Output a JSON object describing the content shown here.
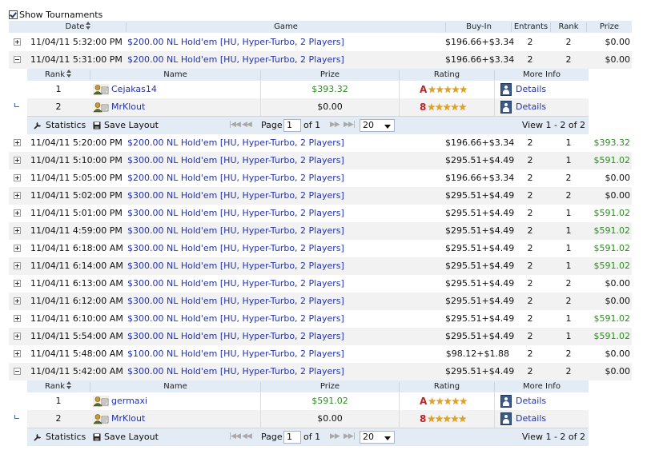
{
  "show_tournaments": {
    "label": "Show Tournaments",
    "checked": true
  },
  "columns": {
    "date": "Date",
    "game": "Game",
    "buyin": "Buy-In",
    "entrants": "Entrants",
    "rank": "Rank",
    "prize": "Prize"
  },
  "sub_columns": {
    "rank": "Rank",
    "name": "Name",
    "prize": "Prize",
    "rating": "Rating",
    "more_info": "More Info"
  },
  "pager": {
    "statistics": "Statistics",
    "save_layout": "Save Layout",
    "page_label": "Page",
    "page_value": "1",
    "of_label": "of 1",
    "page_size": "20",
    "view_text": "View 1 - 2 of 2"
  },
  "colors": {
    "link": "#2233aa",
    "win": "#2e8b22",
    "header_bg": "#e3ebf5",
    "rating_letter": "#c62020"
  },
  "rows": [
    {
      "date": "11/04/11 5:32:00 PM",
      "game": "$200.00 NL Hold'em [HU, Hyper-Turbo, 2 Players]",
      "buyin": "$196.66+$3.34",
      "entrants": "2",
      "rank": "2",
      "prize": "$0.00",
      "expanded": false
    },
    {
      "date": "11/04/11 5:31:00 PM",
      "game": "$200.00 NL Hold'em [HU, Hyper-Turbo, 2 Players]",
      "buyin": "$196.66+$3.34",
      "entrants": "2",
      "rank": "2",
      "prize": "$0.00",
      "expanded": true
    },
    {
      "date": "11/04/11 5:20:00 PM",
      "game": "$200.00 NL Hold'em [HU, Hyper-Turbo, 2 Players]",
      "buyin": "$196.66+$3.34",
      "entrants": "2",
      "rank": "1",
      "prize": "$393.32",
      "expanded": false
    },
    {
      "date": "11/04/11 5:10:00 PM",
      "game": "$300.00 NL Hold'em [HU, Hyper-Turbo, 2 Players]",
      "buyin": "$295.51+$4.49",
      "entrants": "2",
      "rank": "1",
      "prize": "$591.02",
      "expanded": false
    },
    {
      "date": "11/04/11 5:05:00 PM",
      "game": "$200.00 NL Hold'em [HU, Hyper-Turbo, 2 Players]",
      "buyin": "$196.66+$3.34",
      "entrants": "2",
      "rank": "2",
      "prize": "$0.00",
      "expanded": false
    },
    {
      "date": "11/04/11 5:02:00 PM",
      "game": "$300.00 NL Hold'em [HU, Hyper-Turbo, 2 Players]",
      "buyin": "$295.51+$4.49",
      "entrants": "2",
      "rank": "2",
      "prize": "$0.00",
      "expanded": false
    },
    {
      "date": "11/04/11 5:01:00 PM",
      "game": "$300.00 NL Hold'em [HU, Hyper-Turbo, 2 Players]",
      "buyin": "$295.51+$4.49",
      "entrants": "2",
      "rank": "1",
      "prize": "$591.02",
      "expanded": false
    },
    {
      "date": "11/04/11 4:59:00 PM",
      "game": "$300.00 NL Hold'em [HU, Hyper-Turbo, 2 Players]",
      "buyin": "$295.51+$4.49",
      "entrants": "2",
      "rank": "1",
      "prize": "$591.02",
      "expanded": false
    },
    {
      "date": "11/04/11 6:18:00 AM",
      "game": "$300.00 NL Hold'em [HU, Hyper-Turbo, 2 Players]",
      "buyin": "$295.51+$4.49",
      "entrants": "2",
      "rank": "1",
      "prize": "$591.02",
      "expanded": false
    },
    {
      "date": "11/04/11 6:14:00 AM",
      "game": "$300.00 NL Hold'em [HU, Hyper-Turbo, 2 Players]",
      "buyin": "$295.51+$4.49",
      "entrants": "2",
      "rank": "1",
      "prize": "$591.02",
      "expanded": false
    },
    {
      "date": "11/04/11 6:13:00 AM",
      "game": "$300.00 NL Hold'em [HU, Hyper-Turbo, 2 Players]",
      "buyin": "$295.51+$4.49",
      "entrants": "2",
      "rank": "2",
      "prize": "$0.00",
      "expanded": false
    },
    {
      "date": "11/04/11 6:12:00 AM",
      "game": "$300.00 NL Hold'em [HU, Hyper-Turbo, 2 Players]",
      "buyin": "$295.51+$4.49",
      "entrants": "2",
      "rank": "2",
      "prize": "$0.00",
      "expanded": false
    },
    {
      "date": "11/04/11 6:10:00 AM",
      "game": "$300.00 NL Hold'em [HU, Hyper-Turbo, 2 Players]",
      "buyin": "$295.51+$4.49",
      "entrants": "2",
      "rank": "1",
      "prize": "$591.02",
      "expanded": false
    },
    {
      "date": "11/04/11 5:54:00 AM",
      "game": "$300.00 NL Hold'em [HU, Hyper-Turbo, 2 Players]",
      "buyin": "$295.51+$4.49",
      "entrants": "2",
      "rank": "1",
      "prize": "$591.02",
      "expanded": false
    },
    {
      "date": "11/04/11 5:48:00 AM",
      "game": "$100.00 NL Hold'em [HU, Hyper-Turbo, 2 Players]",
      "buyin": "$98.12+$1.88",
      "entrants": "2",
      "rank": "2",
      "prize": "$0.00",
      "expanded": false
    },
    {
      "date": "11/04/11 5:42:00 AM",
      "game": "$300.00 NL Hold'em [HU, Hyper-Turbo, 2 Players]",
      "buyin": "$295.51+$4.49",
      "entrants": "2",
      "rank": "2",
      "prize": "$0.00",
      "expanded": true
    }
  ],
  "subgrids": [
    {
      "players": [
        {
          "rank": "1",
          "name": "Cejakas14",
          "prize": "$393.32",
          "rating_letter": "A",
          "stars": "★★★★★",
          "details": "Details"
        },
        {
          "rank": "2",
          "name": "MrKlout",
          "prize": "$0.00",
          "rating_letter": "8",
          "stars": "★★★★★",
          "details": "Details"
        }
      ]
    },
    {
      "players": [
        {
          "rank": "1",
          "name": "germaxi",
          "prize": "$591.02",
          "rating_letter": "A",
          "stars": "★★★★★",
          "details": "Details"
        },
        {
          "rank": "2",
          "name": "MrKlout",
          "prize": "$0.00",
          "rating_letter": "8",
          "stars": "★★★★★",
          "details": "Details"
        }
      ]
    }
  ]
}
